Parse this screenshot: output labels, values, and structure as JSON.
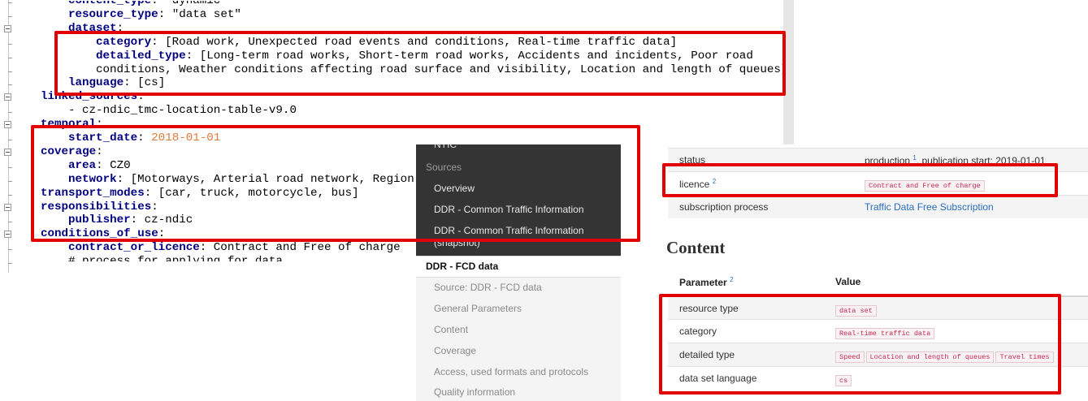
{
  "editor": {
    "lines": [
      {
        "indent": 1,
        "key": "content_type",
        "value": "\"dynamic\"",
        "vclass": "s",
        "partial": "top"
      },
      {
        "indent": 1,
        "key": "resource_type",
        "value": "\"data set\"",
        "vclass": "s"
      },
      {
        "indent": 1,
        "key": "dataset",
        "value": "",
        "vclass": "s"
      },
      {
        "indent": 2,
        "key": "category",
        "value": "[Road work, Unexpected road events and conditions, Real-time traffic data]",
        "vclass": "s"
      },
      {
        "indent": 2,
        "key": "detailed_type",
        "value": "[Long-term road works, Short-term road works, Accidents and incidents, Poor road",
        "vclass": "s"
      },
      {
        "indent": 2,
        "key": "",
        "value": "conditions, Weather conditions affecting road surface and visibility, Location and length of queues]",
        "vclass": "s"
      },
      {
        "indent": 1,
        "key": "language",
        "value": "[cs]",
        "vclass": "s"
      },
      {
        "indent": 0,
        "key": "linked_sources",
        "value": "",
        "vclass": "s"
      },
      {
        "indent": 1,
        "key": "",
        "value": "- cz-ndic_tmc-location-table-v9.0",
        "vclass": "s"
      },
      {
        "indent": 0,
        "key": "temporal",
        "value": "",
        "vclass": "s"
      },
      {
        "indent": 1,
        "key": "start_date",
        "value": "2018-01-01",
        "vclass": "n"
      },
      {
        "indent": 0,
        "key": "coverage",
        "value": "",
        "vclass": "s"
      },
      {
        "indent": 1,
        "key": "area",
        "value": "CZ0",
        "vclass": "s"
      },
      {
        "indent": 1,
        "key": "network",
        "value": "[Motorways, Arterial road network, Region",
        "vclass": "s"
      },
      {
        "indent": 0,
        "key": "transport_modes",
        "value": "[car, truck, motorcycle, bus]",
        "vclass": "s"
      },
      {
        "indent": 0,
        "key": "responsibilities",
        "value": "",
        "vclass": "s"
      },
      {
        "indent": 1,
        "key": "publisher",
        "value": "cz-ndic",
        "vclass": "s"
      },
      {
        "indent": 0,
        "key": "conditions_of_use",
        "value": "",
        "vclass": "s"
      },
      {
        "indent": 1,
        "key": "contract_or_licence",
        "value": "Contract and Free of charge",
        "vclass": "s"
      },
      {
        "indent": 1,
        "key": "",
        "value": "# process for applying for data",
        "vclass": "s",
        "partial": "bottom"
      }
    ]
  },
  "sidebar": {
    "cut_top": "NTIC",
    "sources_header": "Sources",
    "overview": "Overview",
    "ddr_common": "DDR - Common Traffic Information",
    "ddr_common_snapshot_1": "DDR - Common Traffic Information",
    "ddr_common_snapshot_2": "(snapshot)",
    "ddr_fcd": "DDR - FCD data",
    "sub_items": [
      "Source: DDR - FCD data",
      "General Parameters",
      "Content",
      "Coverage",
      "Access, used formats and protocols",
      "Quality information"
    ]
  },
  "meta": {
    "status_label": "status",
    "status_value": "production",
    "status_sup": "1",
    "status_suffix": ", publication start: 2019-01-01",
    "licence_label": "licence",
    "licence_sup": "2",
    "licence_value": "Contract and Free of charge",
    "subscription_label": "subscription process",
    "subscription_value": "Traffic Data Free Subscription",
    "content_title": "Content",
    "param_header": "Parameter",
    "param_sup": "2",
    "value_header": "Value",
    "resource_type_label": "resource type",
    "resource_type_value": "data set",
    "category_label": "category",
    "category_value": "Real-time traffic data",
    "detailed_type_label": "detailed type",
    "detailed_type_values": [
      "Speed",
      "Location and length of queues",
      "Travel times"
    ],
    "language_label": "data set language",
    "language_value": "cs"
  },
  "colors": {
    "highlight": "#e20000",
    "yaml_key": "#000080",
    "date_value": "#e07a3a",
    "badge_text": "#c7254e"
  }
}
